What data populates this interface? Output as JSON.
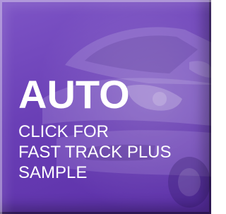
{
  "tile": {
    "title": "AUTO",
    "cta_lines": [
      "CLICK FOR",
      "FAST TRACK PLUS",
      "SAMPLE"
    ],
    "colors": {
      "background": "#6a3fb6",
      "text": "#ffffff"
    },
    "image": "car-icon"
  }
}
